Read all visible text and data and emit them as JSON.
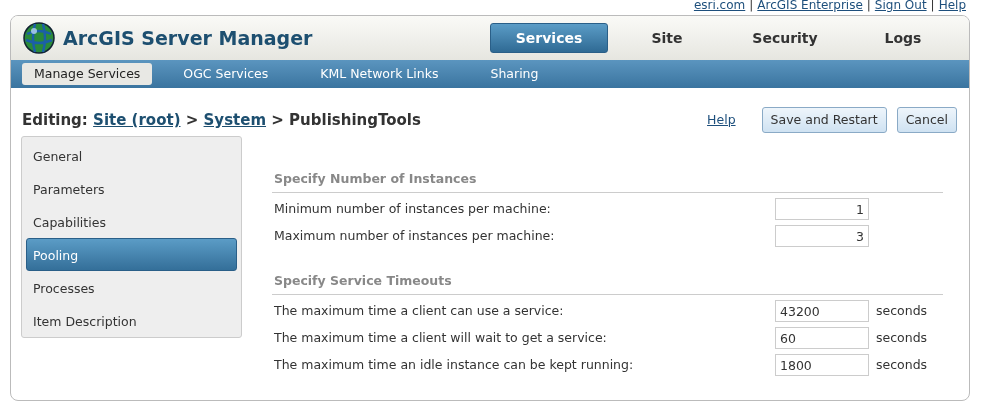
{
  "top_links": [
    "esri.com",
    "ArcGIS Enterprise",
    "Sign Out",
    "Help"
  ],
  "top_link_separator": "|",
  "app": {
    "title": "ArcGIS Server Manager"
  },
  "main_tabs": [
    {
      "label": "Services",
      "selected": true
    },
    {
      "label": "Site",
      "selected": false
    },
    {
      "label": "Security",
      "selected": false
    },
    {
      "label": "Logs",
      "selected": false
    }
  ],
  "sub_tabs": [
    {
      "label": "Manage Services",
      "selected": true
    },
    {
      "label": "OGC Services",
      "selected": false
    },
    {
      "label": "KML Network Links",
      "selected": false
    },
    {
      "label": "Sharing",
      "selected": false
    }
  ],
  "breadcrumb": {
    "prefix": "Editing:",
    "links": [
      "Site (root)",
      "System"
    ],
    "current": "PublishingTools",
    "separator": ">"
  },
  "actions": {
    "help": "Help",
    "buttons": [
      "Save and Restart",
      "Cancel"
    ]
  },
  "sidebar": {
    "items": [
      {
        "label": "General",
        "selected": false
      },
      {
        "label": "Parameters",
        "selected": false
      },
      {
        "label": "Capabilities",
        "selected": false
      },
      {
        "label": "Pooling",
        "selected": true
      },
      {
        "label": "Processes",
        "selected": false
      },
      {
        "label": "Item Description",
        "selected": false
      }
    ]
  },
  "sections": [
    {
      "title": "Specify Number of Instances",
      "kind": "count",
      "rows": [
        {
          "label": "Minimum number of instances per machine:",
          "value": "1"
        },
        {
          "label": "Maximum number of instances per machine:",
          "value": "3"
        }
      ]
    },
    {
      "title": "Specify Service Timeouts",
      "kind": "timeout",
      "rows": [
        {
          "label": "The maximum time a client can use a service:",
          "value": "43200",
          "unit": "seconds"
        },
        {
          "label": "The maximum time a client will wait to get a service:",
          "value": "60",
          "unit": "seconds"
        },
        {
          "label": "The maximum time an idle instance can be kept running:",
          "value": "1800",
          "unit": "seconds"
        }
      ]
    }
  ]
}
